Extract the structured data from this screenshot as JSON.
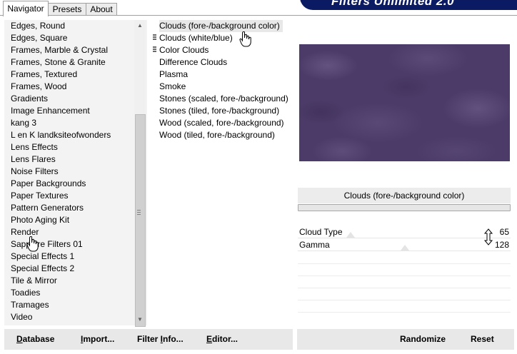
{
  "tabs": [
    {
      "label": "Navigator",
      "active": true
    },
    {
      "label": "Presets",
      "active": false
    },
    {
      "label": "About",
      "active": false
    }
  ],
  "banner": {
    "text": "Filters Unlimited 2.0"
  },
  "categories": [
    "Edges, Round",
    "Edges, Square",
    "Frames, Marble & Crystal",
    "Frames, Stone & Granite",
    "Frames, Textured",
    "Frames, Wood",
    "Gradients",
    "Image Enhancement",
    "kang 3",
    "L en K landksiteofwonders",
    "Lens Effects",
    "Lens Flares",
    "Noise Filters",
    "Paper Backgrounds",
    "Paper Textures",
    "Pattern Generators",
    "Photo Aging Kit",
    "Render",
    "Sapphire Filters 01",
    "Special Effects 1",
    "Special Effects 2",
    "Tile & Mirror",
    "Toadies",
    "Tramages",
    "Video"
  ],
  "filters": [
    "Clouds (fore-/background color)",
    "Clouds (white/blue)",
    "Color Clouds",
    "Difference Clouds",
    "Plasma",
    "Smoke",
    "Stones (scaled, fore-/background)",
    "Stones (tiled, fore-/background)",
    "Wood (scaled, fore-/background)",
    "Wood (tiled, fore-/background)"
  ],
  "selected_filter": "Clouds (fore-/background color)",
  "filter_title": "Clouds (fore-/background color)",
  "params": [
    {
      "label": "Cloud Type",
      "value": "65"
    },
    {
      "label": "Gamma",
      "value": "128"
    }
  ],
  "buttons": {
    "database": {
      "first": "D",
      "rest": "atabase"
    },
    "import": {
      "first": "I",
      "rest": "mport..."
    },
    "filter_info": {
      "first": "Filter ",
      "mid": "I",
      "rest": "nfo..."
    },
    "editor": {
      "first": "E",
      "rest": "ditor..."
    },
    "randomize": "Randomize",
    "reset": "Reset"
  },
  "colors": {
    "banner_bg": "#0b1b63",
    "preview_base": "#4c3b68"
  }
}
